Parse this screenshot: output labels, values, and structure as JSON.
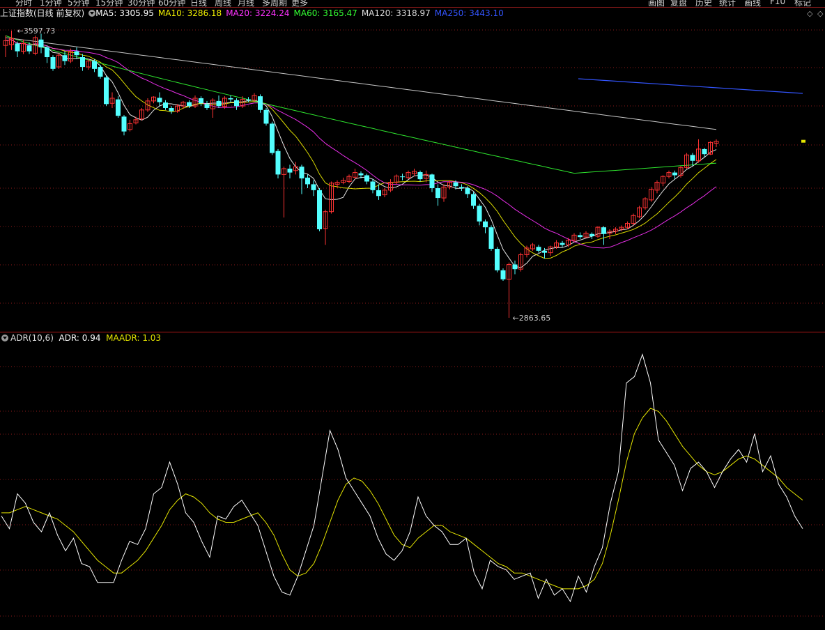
{
  "top_tabs": [
    "分时",
    "1分钟",
    "5分钟",
    "15分钟",
    "30分钟",
    "60分钟",
    "日线",
    "周线",
    "月线",
    "多周期",
    "更多"
  ],
  "top_right_tabs": [
    "画图",
    "复盘",
    "历史",
    "统计",
    "画线",
    "F10",
    "标记"
  ],
  "main": {
    "index_name": "上证指数(日线 前复权)",
    "ma": [
      {
        "label": "MA5: 3305.95",
        "color": "#ffffff"
      },
      {
        "label": "MA10: 3286.18",
        "color": "#f2f200"
      },
      {
        "label": "MA20: 3224.24",
        "color": "#ff33ff"
      },
      {
        "label": "MA60: 3165.47",
        "color": "#33ff33"
      },
      {
        "label": "MA120: 3318.97",
        "color": "#dddddd"
      },
      {
        "label": "MA250: 3443.10",
        "color": "#3355ff"
      }
    ],
    "high_label": "3597.73",
    "low_label": "2863.65"
  },
  "indicator": {
    "name": "ADR(10,6)",
    "adr_label": "ADR: 0.94",
    "maadr_label": "MAADR: 1.03",
    "adr_color": "#ffffff",
    "maadr_color": "#e5e500"
  },
  "colors": {
    "up": "#ff3333",
    "down": "#54ffff",
    "grid": "#8b1a1a",
    "bg": "#000000"
  },
  "chart_data": {
    "type": "candlestick",
    "price_range": [
      2863.65,
      3597.73
    ],
    "candles": [
      [
        3560,
        3572,
        3530,
        3585
      ],
      [
        3562,
        3578,
        3548,
        3597.73
      ],
      [
        3565,
        3545,
        3530,
        3570
      ],
      [
        3545,
        3565,
        3538,
        3575
      ],
      [
        3560,
        3545,
        3538,
        3568
      ],
      [
        3540,
        3580,
        3535,
        3585
      ],
      [
        3575,
        3555,
        3540,
        3590
      ],
      [
        3555,
        3530,
        3515,
        3560
      ],
      [
        3530,
        3500,
        3495,
        3535
      ],
      [
        3505,
        3535,
        3500,
        3540
      ],
      [
        3535,
        3520,
        3510,
        3545
      ],
      [
        3520,
        3545,
        3515,
        3552
      ],
      [
        3545,
        3535,
        3525,
        3555
      ],
      [
        3530,
        3505,
        3495,
        3538
      ],
      [
        3505,
        3520,
        3498,
        3525
      ],
      [
        3520,
        3500,
        3492,
        3525
      ],
      [
        3505,
        3480,
        3475,
        3510
      ],
      [
        3478,
        3410,
        3405,
        3482
      ],
      [
        3412,
        3425,
        3400,
        3440
      ],
      [
        3422,
        3380,
        3375,
        3430
      ],
      [
        3378,
        3340,
        3330,
        3382
      ],
      [
        3345,
        3360,
        3340,
        3370
      ],
      [
        3362,
        3370,
        3358,
        3378
      ],
      [
        3372,
        3395,
        3368,
        3400
      ],
      [
        3395,
        3418,
        3390,
        3425
      ],
      [
        3418,
        3428,
        3412,
        3430
      ],
      [
        3426,
        3415,
        3405,
        3440
      ],
      [
        3414,
        3400,
        3395,
        3420
      ],
      [
        3400,
        3392,
        3385,
        3405
      ],
      [
        3392,
        3405,
        3388,
        3410
      ],
      [
        3405,
        3415,
        3398,
        3418
      ],
      [
        3415,
        3405,
        3400,
        3420
      ],
      [
        3405,
        3425,
        3400,
        3432
      ],
      [
        3425,
        3412,
        3405,
        3430
      ],
      [
        3410,
        3400,
        3395,
        3418
      ],
      [
        3398,
        3420,
        3375,
        3425
      ],
      [
        3418,
        3405,
        3400,
        3432
      ],
      [
        3404,
        3425,
        3398,
        3430
      ],
      [
        3425,
        3422,
        3415,
        3432
      ],
      [
        3420,
        3405,
        3395,
        3425
      ],
      [
        3405,
        3422,
        3400,
        3430
      ],
      [
        3422,
        3420,
        3415,
        3428
      ],
      [
        3420,
        3432,
        3415,
        3438
      ],
      [
        3430,
        3395,
        3388,
        3435
      ],
      [
        3395,
        3360,
        3355,
        3400
      ],
      [
        3360,
        3285,
        3280,
        3365
      ],
      [
        3290,
        3230,
        3220,
        3295
      ],
      [
        3230,
        3245,
        3120,
        3250
      ],
      [
        3245,
        3235,
        3220,
        3255
      ],
      [
        3240,
        3250,
        3230,
        3262
      ],
      [
        3250,
        3220,
        3180,
        3255
      ],
      [
        3222,
        3205,
        3195,
        3230
      ],
      [
        3205,
        3190,
        3175,
        3215
      ],
      [
        3190,
        3090,
        3085,
        3195
      ],
      [
        3092,
        3135,
        3050,
        3140
      ],
      [
        3135,
        3208,
        3130,
        3212
      ],
      [
        3205,
        3210,
        3195,
        3215
      ],
      [
        3210,
        3215,
        3205,
        3222
      ],
      [
        3212,
        3225,
        3208,
        3230
      ],
      [
        3223,
        3235,
        3218,
        3245
      ],
      [
        3233,
        3228,
        3220,
        3238
      ],
      [
        3228,
        3212,
        3205,
        3232
      ],
      [
        3212,
        3190,
        3182,
        3218
      ],
      [
        3190,
        3175,
        3165,
        3205
      ],
      [
        3178,
        3190,
        3172,
        3195
      ],
      [
        3190,
        3210,
        3185,
        3218
      ],
      [
        3210,
        3226,
        3205,
        3230
      ],
      [
        3225,
        3224,
        3215,
        3232
      ],
      [
        3222,
        3235,
        3218,
        3240
      ],
      [
        3232,
        3238,
        3225,
        3245
      ],
      [
        3236,
        3218,
        3212,
        3240
      ],
      [
        3220,
        3230,
        3210,
        3240
      ],
      [
        3230,
        3195,
        3185,
        3232
      ],
      [
        3195,
        3170,
        3150,
        3205
      ],
      [
        3170,
        3198,
        3160,
        3205
      ],
      [
        3198,
        3210,
        3192,
        3215
      ],
      [
        3210,
        3200,
        3192,
        3215
      ],
      [
        3198,
        3195,
        3188,
        3205
      ],
      [
        3195,
        3180,
        3170,
        3200
      ],
      [
        3180,
        3150,
        3142,
        3185
      ],
      [
        3150,
        3110,
        3100,
        3155
      ],
      [
        3110,
        3095,
        3080,
        3115
      ],
      [
        3095,
        3040,
        3035,
        3100
      ],
      [
        3040,
        2985,
        2980,
        3045
      ],
      [
        2985,
        2962,
        2958,
        2990
      ],
      [
        2962,
        3000,
        2863.65,
        3005
      ],
      [
        3000,
        2988,
        2975,
        3010
      ],
      [
        2988,
        3025,
        2982,
        3030
      ],
      [
        3025,
        3042,
        3018,
        3048
      ],
      [
        3040,
        3050,
        3035,
        3055
      ],
      [
        3045,
        3035,
        3030,
        3050
      ],
      [
        3035,
        3030,
        3015,
        3042
      ],
      [
        3030,
        3045,
        3022,
        3048
      ],
      [
        3045,
        3055,
        3040,
        3062
      ],
      [
        3055,
        3050,
        3045,
        3060
      ],
      [
        3050,
        3062,
        3045,
        3068
      ],
      [
        3062,
        3075,
        3058,
        3080
      ],
      [
        3075,
        3070,
        3065,
        3082
      ],
      [
        3070,
        3080,
        3068,
        3085
      ],
      [
        3078,
        3072,
        3065,
        3082
      ],
      [
        3072,
        3095,
        3068,
        3098
      ],
      [
        3095,
        3078,
        3050,
        3098
      ],
      [
        3080,
        3085,
        3065,
        3090
      ],
      [
        3085,
        3090,
        3078,
        3095
      ],
      [
        3090,
        3095,
        3085,
        3100
      ],
      [
        3095,
        3105,
        3090,
        3110
      ],
      [
        3105,
        3125,
        3100,
        3130
      ],
      [
        3122,
        3145,
        3118,
        3150
      ],
      [
        3145,
        3168,
        3140,
        3172
      ],
      [
        3165,
        3192,
        3160,
        3198
      ],
      [
        3190,
        3210,
        3182,
        3215
      ],
      [
        3208,
        3225,
        3200,
        3228
      ],
      [
        3225,
        3235,
        3220,
        3240
      ],
      [
        3235,
        3228,
        3218,
        3240
      ],
      [
        3228,
        3248,
        3222,
        3252
      ],
      [
        3248,
        3280,
        3245,
        3285
      ],
      [
        3280,
        3265,
        3252,
        3285
      ],
      [
        3265,
        3295,
        3260,
        3320
      ],
      [
        3295,
        3282,
        3275,
        3298
      ],
      [
        3282,
        3312,
        3280,
        3315
      ],
      [
        3310,
        3315,
        3300,
        3320
      ]
    ],
    "adr": [
      0.98,
      0.94,
      1.05,
      1.02,
      0.96,
      0.93,
      0.99,
      0.92,
      0.87,
      0.91,
      0.83,
      0.82,
      0.77,
      0.77,
      0.77,
      0.84,
      0.9,
      0.89,
      0.94,
      1.05,
      1.07,
      1.15,
      1.08,
      0.99,
      0.96,
      0.9,
      0.85,
      0.98,
      0.97,
      1.01,
      1.03,
      0.99,
      0.95,
      0.87,
      0.79,
      0.74,
      0.73,
      0.79,
      0.87,
      0.95,
      1.1,
      1.25,
      1.19,
      1.1,
      1.06,
      1.02,
      0.98,
      0.91,
      0.86,
      0.84,
      0.87,
      0.93,
      1.04,
      0.98,
      0.95,
      0.93,
      0.89,
      0.89,
      0.91,
      0.8,
      0.75,
      0.84,
      0.82,
      0.81,
      0.78,
      0.79,
      0.8,
      0.72,
      0.78,
      0.73,
      0.75,
      0.71,
      0.79,
      0.74,
      0.82,
      0.88,
      1.02,
      1.12,
      1.4,
      1.42,
      1.49,
      1.4,
      1.22,
      1.18,
      1.14,
      1.06,
      1.13,
      1.15,
      1.12,
      1.07,
      1.12,
      1.16,
      1.19,
      1.15,
      1.24,
      1.12,
      1.17,
      1.08,
      1.04,
      0.98,
      0.94
    ],
    "maadr": [
      0.99,
      0.99,
      1.0,
      1.01,
      1.0,
      0.99,
      0.98,
      0.97,
      0.95,
      0.93,
      0.9,
      0.87,
      0.84,
      0.82,
      0.8,
      0.8,
      0.82,
      0.84,
      0.87,
      0.91,
      0.95,
      1.0,
      1.03,
      1.05,
      1.04,
      1.02,
      0.99,
      0.97,
      0.96,
      0.96,
      0.97,
      0.98,
      0.99,
      0.96,
      0.92,
      0.86,
      0.81,
      0.79,
      0.8,
      0.83,
      0.89,
      0.96,
      1.03,
      1.08,
      1.1,
      1.09,
      1.06,
      1.02,
      0.97,
      0.92,
      0.89,
      0.88,
      0.91,
      0.93,
      0.95,
      0.95,
      0.93,
      0.92,
      0.91,
      0.89,
      0.87,
      0.85,
      0.83,
      0.82,
      0.8,
      0.8,
      0.79,
      0.78,
      0.77,
      0.76,
      0.75,
      0.75,
      0.75,
      0.76,
      0.78,
      0.83,
      0.92,
      1.03,
      1.15,
      1.24,
      1.29,
      1.32,
      1.31,
      1.28,
      1.24,
      1.2,
      1.17,
      1.14,
      1.12,
      1.11,
      1.12,
      1.14,
      1.16,
      1.17,
      1.16,
      1.14,
      1.12,
      1.1,
      1.07,
      1.05,
      1.03
    ]
  }
}
